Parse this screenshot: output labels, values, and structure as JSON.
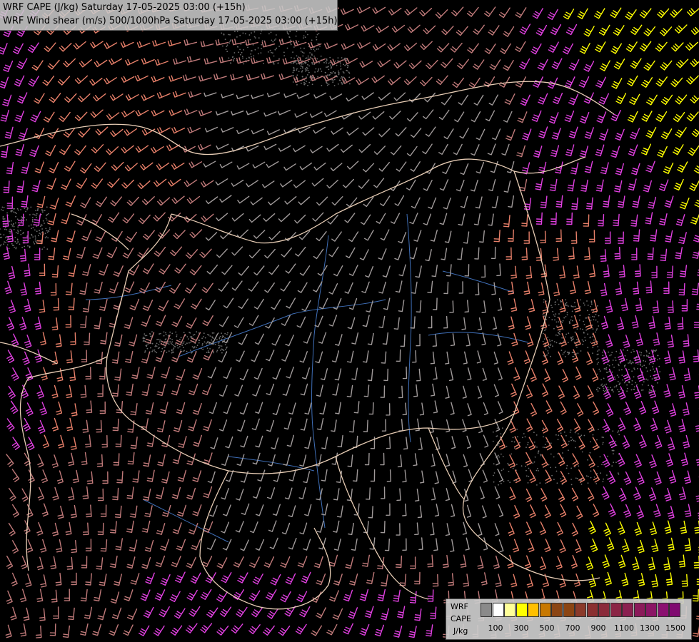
{
  "titles": {
    "line1": "WRF CAPE (J/kg) Saturday 17-05-2025 03:00 (+15h)",
    "line2": "WRF Wind shear (m/s) 500/1000hPa Saturday 17-05-2025 03:00 (+15h)"
  },
  "legend": {
    "l1": "WRF",
    "l2": "CAPE",
    "l3": "J/kg",
    "colors": [
      "#8a8a8a",
      "#ffffff",
      "#ffff99",
      "#ffff00",
      "#ffc000",
      "#c87800",
      "#8b4513",
      "#8b4513",
      "#8b3a2a",
      "#8b3030",
      "#8b2a3a",
      "#8b2545",
      "#8b2050",
      "#8b1a5a",
      "#8b1565",
      "#8b1070",
      "#800a70"
    ],
    "ticks": [
      "100",
      "300",
      "500",
      "700",
      "900",
      "1100",
      "1300",
      "1500"
    ]
  },
  "palette": {
    "background": "#000000",
    "borders": "#e8d0b8",
    "rivers": "#4a7fc8",
    "barb_gray": "#a09a9a",
    "barb_rose": "#c07a7a",
    "barb_salmon": "#e8806a",
    "barb_magenta": "#e040e0",
    "barb_yellow": "#ffff00"
  },
  "map": {
    "region": "Hungary and surrounding countries",
    "layers": [
      "CAPE shading",
      "wind shear barbs 500/1000hPa",
      "country borders",
      "rivers"
    ]
  }
}
